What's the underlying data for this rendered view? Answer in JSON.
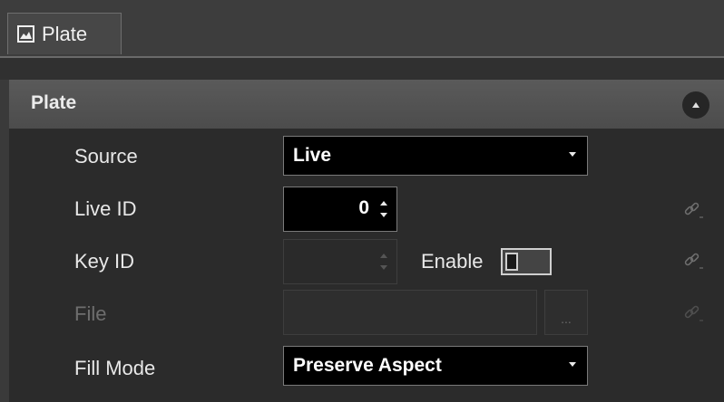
{
  "tab": {
    "label": "Plate",
    "icon": "image-icon"
  },
  "section": {
    "title": "Plate",
    "collapse_icon": "chevron-up-icon"
  },
  "fields": {
    "source": {
      "label": "Source",
      "value": "Live"
    },
    "live_id": {
      "label": "Live ID",
      "value": "0"
    },
    "key_id": {
      "label": "Key ID",
      "value": "",
      "enable_label": "Enable",
      "enable_checked": false
    },
    "file": {
      "label": "File",
      "value": "",
      "browse_label": "..."
    },
    "fill_mode": {
      "label": "Fill Mode",
      "value": "Preserve Aspect"
    }
  },
  "icons": {
    "link": "link-icon"
  }
}
